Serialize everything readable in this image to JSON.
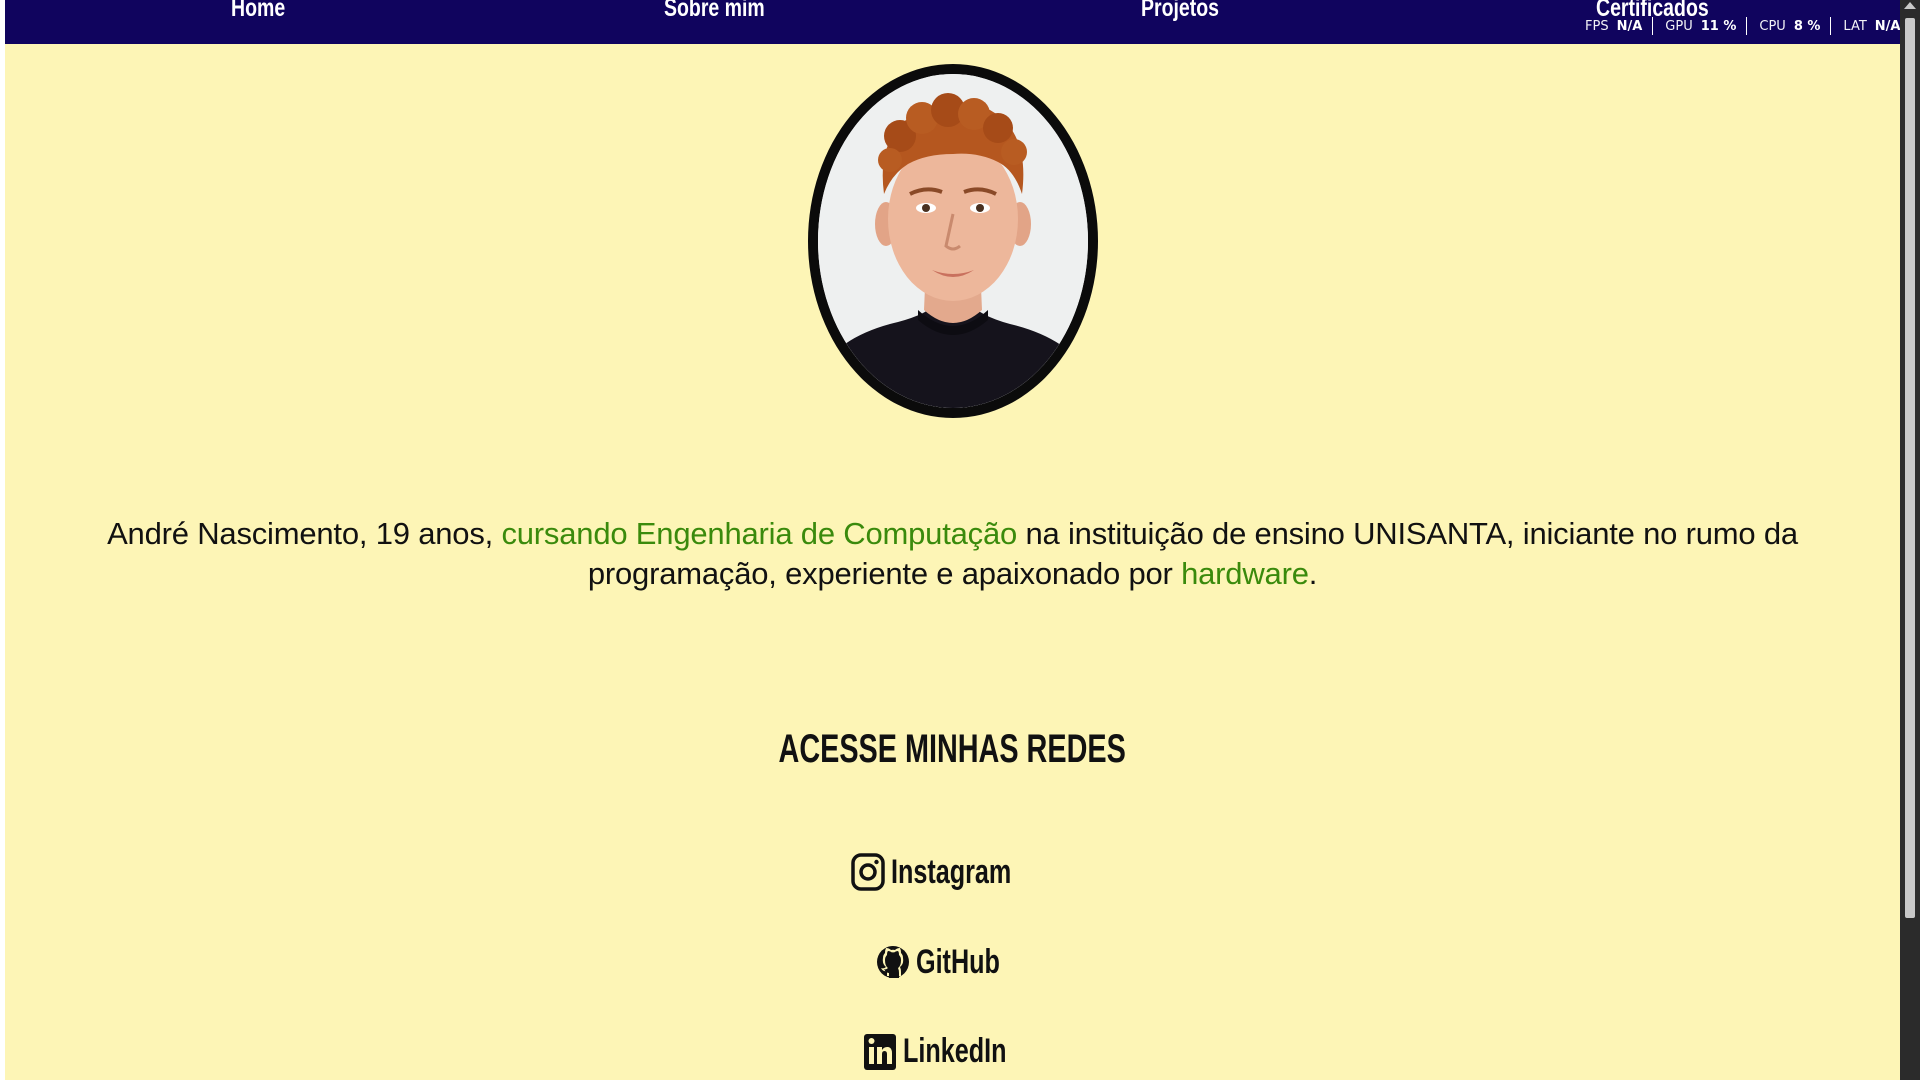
{
  "nav": {
    "home": "Home",
    "about": "Sobre mim",
    "projects": "Projetos",
    "certificates": "Certificados"
  },
  "perf": {
    "fps_label": "FPS",
    "fps_value": "N/A",
    "gpu_label": "GPU",
    "gpu_value": "11 %",
    "cpu_label": "CPU",
    "cpu_value": "8 %",
    "lat_label": "LAT",
    "lat_value": "N/A"
  },
  "profile": {
    "image_icon": "profile-photo"
  },
  "bio": {
    "part1": "André Nascimento, 19 anos, ",
    "highlight1": "cursando Engenharia de Computação",
    "part2": " na instituição de ensino UNISANTA, iniciante no rumo da programação, experiente e apaixonado por ",
    "highlight2": "hardware",
    "part3": "."
  },
  "social": {
    "title": "ACESSE MINHAS REDES",
    "instagram": "Instagram",
    "github": "GitHub",
    "linkedin": "LinkedIn"
  },
  "colors": {
    "page_bg": "#fdf5b6",
    "nav_bg": "#10045e",
    "highlight": "#3a8a0c",
    "text": "#111111"
  }
}
